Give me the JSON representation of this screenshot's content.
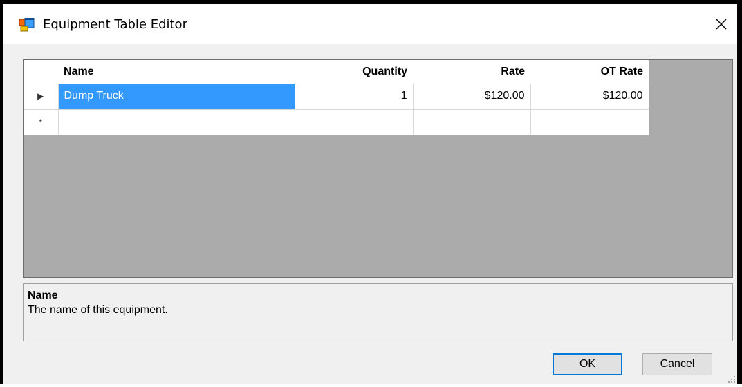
{
  "window": {
    "title": "Equipment Table Editor",
    "icons": {
      "app": "form-app-icon",
      "close": "close-icon"
    }
  },
  "grid": {
    "columns": [
      "Name",
      "Quantity",
      "Rate",
      "OT Rate"
    ],
    "rows": [
      {
        "marker": "▶",
        "name": "Dump Truck",
        "quantity": "1",
        "rate": "$120.00",
        "ot_rate": "$120.00"
      }
    ],
    "new_row_marker": "*",
    "colors": {
      "background": "#ababab",
      "selection": "#3399ff"
    }
  },
  "description": {
    "title": "Name",
    "text": "The name of this equipment."
  },
  "buttons": {
    "ok": "OK",
    "cancel": "Cancel"
  }
}
